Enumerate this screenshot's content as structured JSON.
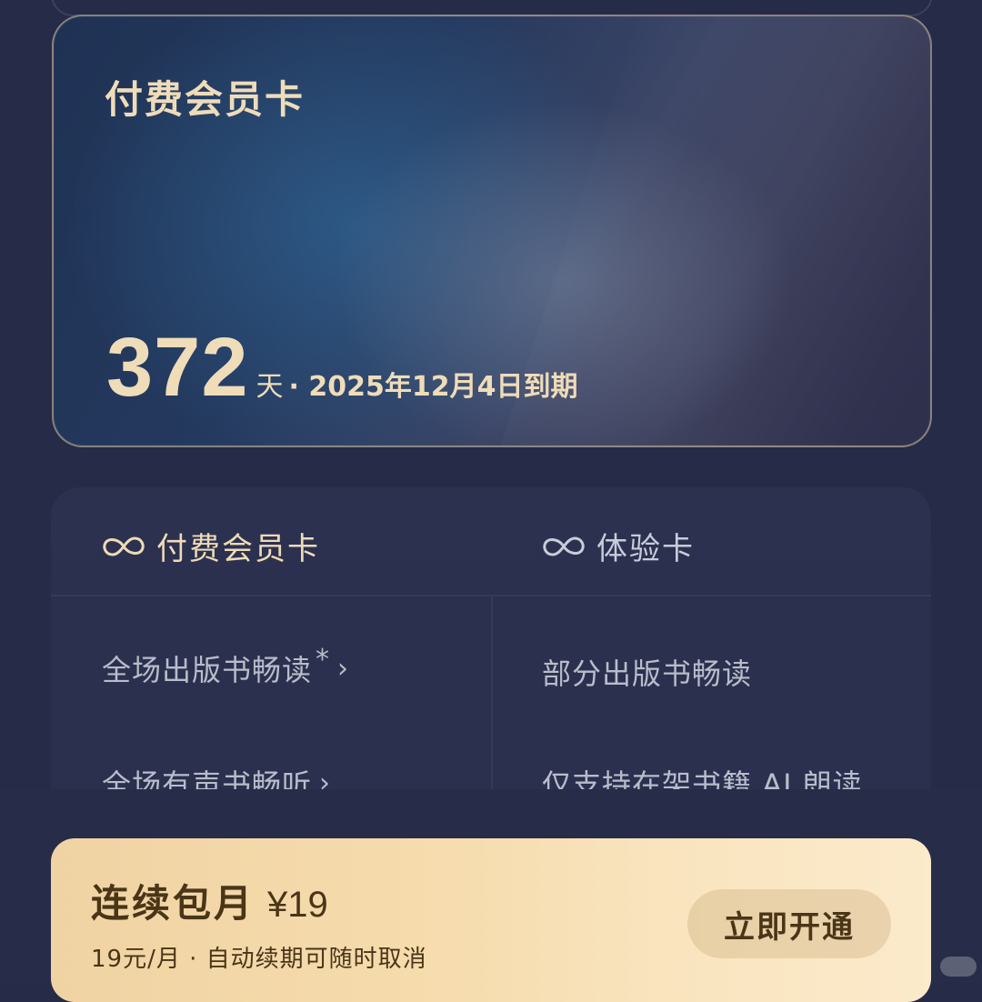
{
  "card": {
    "title": "付费会员卡",
    "days": "372",
    "days_unit": "天",
    "expiry": "· 2025年12月4日到期"
  },
  "compare": {
    "left_title": "付费会员卡",
    "right_title": "体验卡",
    "left_features": [
      "全场出版书畅读",
      "全场有声书畅听"
    ],
    "left_star": "*",
    "right_features": [
      "部分出版书畅读",
      "仅支持在架书籍 AI 朗读"
    ],
    "icon": "infinity-icon",
    "chevron_icon": "chevron-right-icon"
  },
  "plan": {
    "name": "连续包月",
    "price": "¥19",
    "note": "19元/月 · 自动续期可随时取消",
    "button_label": "立即开通"
  },
  "colors": {
    "gold_text": "#efdcb8",
    "background": "#262b47",
    "plan_card": "#f6dcae",
    "plan_text": "#4a3517"
  }
}
